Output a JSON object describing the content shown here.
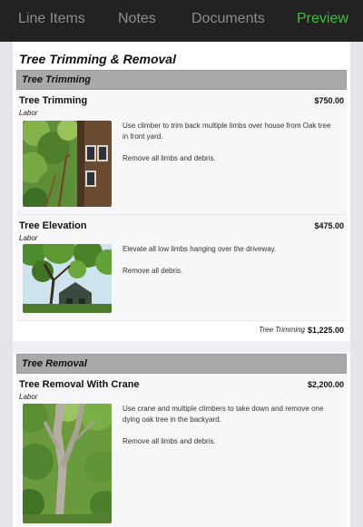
{
  "nav": {
    "tabs": [
      {
        "label": "Line Items",
        "active": false
      },
      {
        "label": "Notes",
        "active": false
      },
      {
        "label": "Documents",
        "active": false
      },
      {
        "label": "Preview",
        "active": true
      }
    ],
    "colors": {
      "bar": "#222222",
      "inactive": "#8d8d8d",
      "active": "#3ec13c"
    }
  },
  "document": {
    "title": "Tree Trimming & Removal",
    "groups": [
      {
        "name": "Tree Trimming",
        "items": [
          {
            "name": "Tree Trimming",
            "type": "Labor",
            "price": "$750.00",
            "photo": "tree-trimming-photo",
            "description": [
              "Use climber to trim back multiple limbs over house from Oak tree in front yard.",
              "Remove all limbs and debris."
            ]
          },
          {
            "name": "Tree Elevation",
            "type": "Labor",
            "price": "$475.00",
            "photo": "tree-elevation-photo",
            "description": [
              "Elevate all low limbs hanging over the driveway.",
              "Remove all debris."
            ]
          }
        ],
        "subtotal_label": "Tree Trimming",
        "subtotal_value": "$1,225.00"
      },
      {
        "name": "Tree Removal",
        "items": [
          {
            "name": "Tree Removal With Crane",
            "type": "Labor",
            "price": "$2,200.00",
            "photo": "tree-removal-photo",
            "description": [
              "Use crane and multiple climbers to take down and remove one dying oak tree in the backyard.",
              "Remove all limbs and debris."
            ]
          }
        ]
      }
    ]
  }
}
